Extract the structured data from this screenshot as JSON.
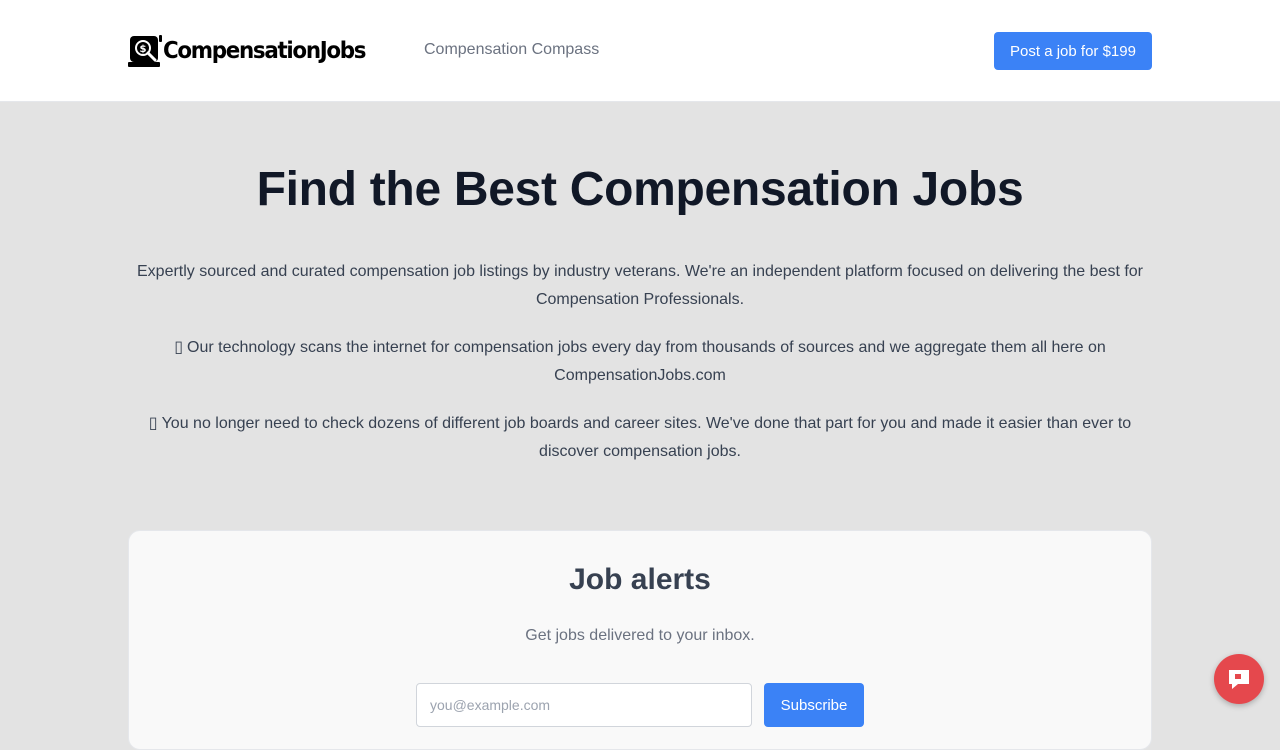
{
  "brand": {
    "name": "CompensationJobs",
    "logo_icon": "dollar-search-icon"
  },
  "nav": {
    "link_label": "Compensation Compass",
    "post_job_label": "Post a job for $199"
  },
  "hero": {
    "title": "Find the Best Compensation Jobs",
    "paragraphs": [
      {
        "emoji": "",
        "text": "Expertly sourced and curated compensation job listings by industry veterans. We're an independent platform focused on delivering the best for Compensation Professionals."
      },
      {
        "emoji": "▯",
        "text": "Our technology scans the internet for compensation jobs every day from thousands of sources and we aggregate them all here on CompensationJobs.com"
      },
      {
        "emoji": "▯",
        "text": "You no longer need to check dozens of different job boards and career sites. We've done that part for you and made it easier than ever to discover compensation jobs."
      }
    ]
  },
  "alerts": {
    "title": "Job alerts",
    "subtitle": "Get jobs delivered to your inbox.",
    "email_placeholder": "you@example.com",
    "email_value": "",
    "subscribe_label": "Subscribe"
  },
  "chat": {
    "icon": "chat-bubble-icon"
  },
  "colors": {
    "accent": "#3b82f6",
    "chat": "#e5484d",
    "title": "#111827"
  }
}
